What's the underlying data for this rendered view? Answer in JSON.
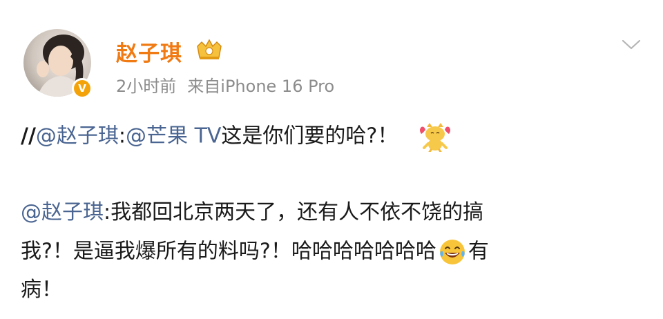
{
  "header": {
    "username": "赵子琪",
    "time": "2小时前",
    "source": "来自iPhone 16 Pro",
    "verified_badge": "V",
    "icons": [
      "crown-badge-icon",
      "verified-badge-icon",
      "chevron-down-icon"
    ]
  },
  "repost": {
    "prefix": "//",
    "mention_user": "@赵子琪",
    "colon": ":",
    "mention_tv": "@芒果 TV",
    "text": "这是你们要的哈?！",
    "emoji": "cat-heart-emoji"
  },
  "original": {
    "mention_user": "@赵子琪",
    "line1": ":我都回北京两天了，还有人不依不饶的搞",
    "line2_a": "我?！是逼我爆所有的料吗?！哈哈哈哈哈哈哈",
    "line2_b": "有",
    "line3": "病！",
    "emoji": "laughing-tears-emoji"
  },
  "colors": {
    "username": "#f07a13",
    "mention": "#4a6591",
    "meta": "#8c8c8c",
    "badge": "#f3a20a"
  }
}
